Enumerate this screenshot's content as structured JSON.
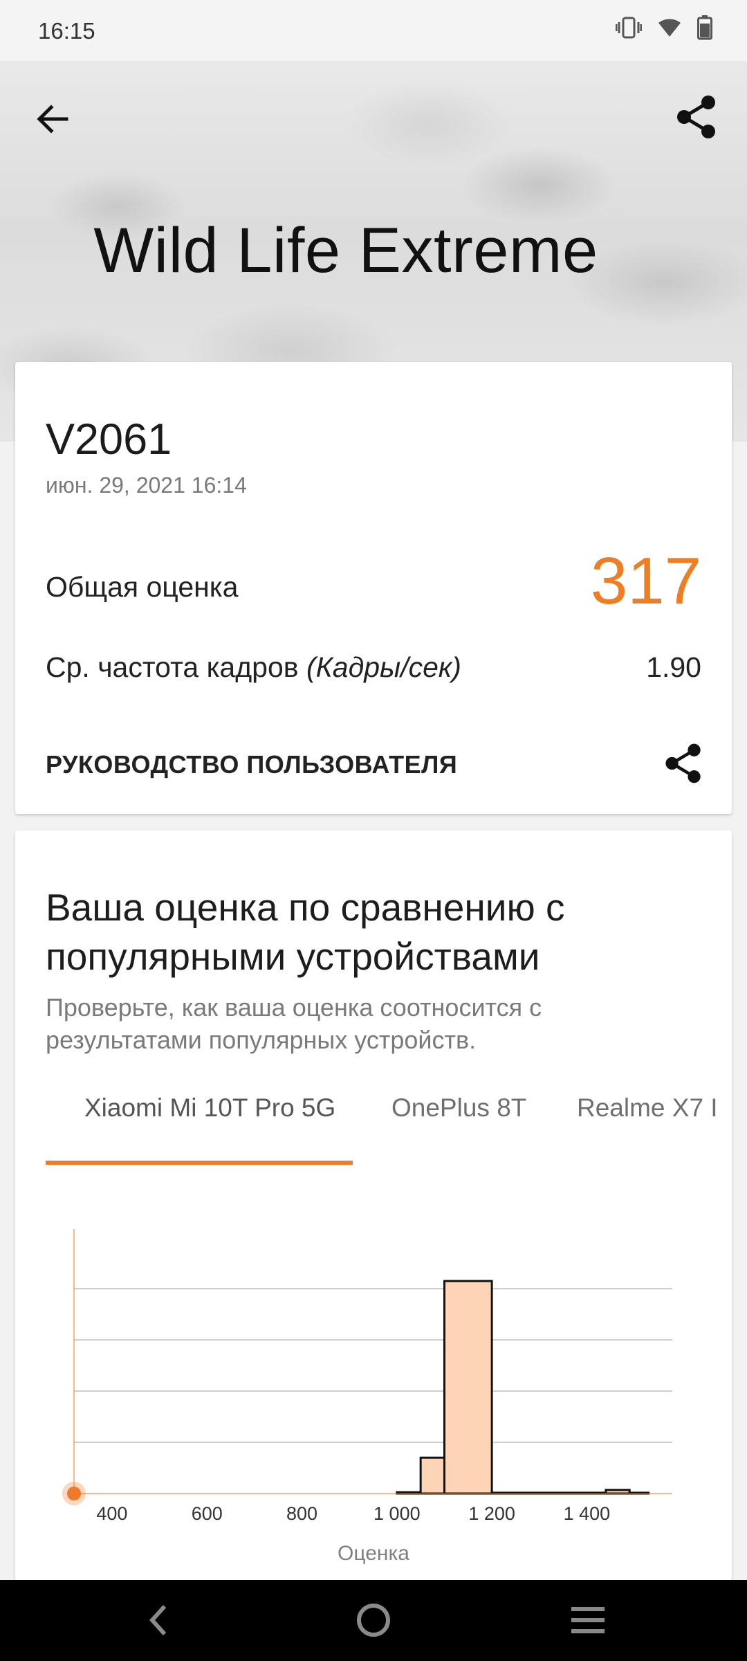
{
  "status_bar": {
    "time": "16:15",
    "icons": [
      "vibrate-icon",
      "wifi-icon",
      "battery-icon"
    ]
  },
  "header": {
    "title": "Wild Life Extreme",
    "back_icon": "arrow-left-icon",
    "share_icon": "share-icon"
  },
  "result": {
    "device": "V2061",
    "date": "июн. 29, 2021 16:14",
    "score_label": "Общая оценка",
    "score_value": "317",
    "fps_label": "Ср. частота кадров",
    "fps_unit": "(Кадры/сек)",
    "fps_value": "1.90",
    "guide_label": "РУКОВОДСТВО ПОЛЬЗОВАТЕЛЯ"
  },
  "comparison": {
    "title": "Ваша оценка по сравнению с популярными устройствами",
    "subtitle": "Проверьте, как ваша оценка соотносится с результатами популярных устройств.",
    "tabs": [
      {
        "label": "Xiaomi Mi 10T Pro 5G",
        "active": true
      },
      {
        "label": "OnePlus 8T",
        "active": false
      },
      {
        "label": "Realme X7 I",
        "active": false
      }
    ]
  },
  "chart_data": {
    "type": "bar",
    "xlabel": "Оценка",
    "ylabel": "",
    "x_ticks": [
      400,
      600,
      800,
      1000,
      1200,
      1400
    ],
    "x_tick_labels": [
      "400",
      "600",
      "800",
      "1 000",
      "1 200",
      "1 400"
    ],
    "xlim": [
      320,
      1580
    ],
    "ylim": [
      0,
      100
    ],
    "gridlines": [
      20,
      40,
      60,
      80
    ],
    "bins": [
      {
        "x0": 1000,
        "x1": 1050,
        "value": 0.5
      },
      {
        "x0": 1050,
        "x1": 1100,
        "value": 14
      },
      {
        "x0": 1100,
        "x1": 1200,
        "value": 83
      },
      {
        "x0": 1200,
        "x1": 1440,
        "value": 0.3
      },
      {
        "x0": 1440,
        "x1": 1490,
        "value": 1.4
      },
      {
        "x0": 1490,
        "x1": 1530,
        "value": 0.3
      }
    ],
    "your_score": 317,
    "colors": {
      "bar_fill": "#fdd5b6",
      "accent": "#ee7d24",
      "marker": "#ef7a2c",
      "grid": "#bdbdbd"
    }
  },
  "nav_bar": {
    "icons": [
      "nav-back-icon",
      "nav-home-icon",
      "nav-menu-icon"
    ]
  }
}
